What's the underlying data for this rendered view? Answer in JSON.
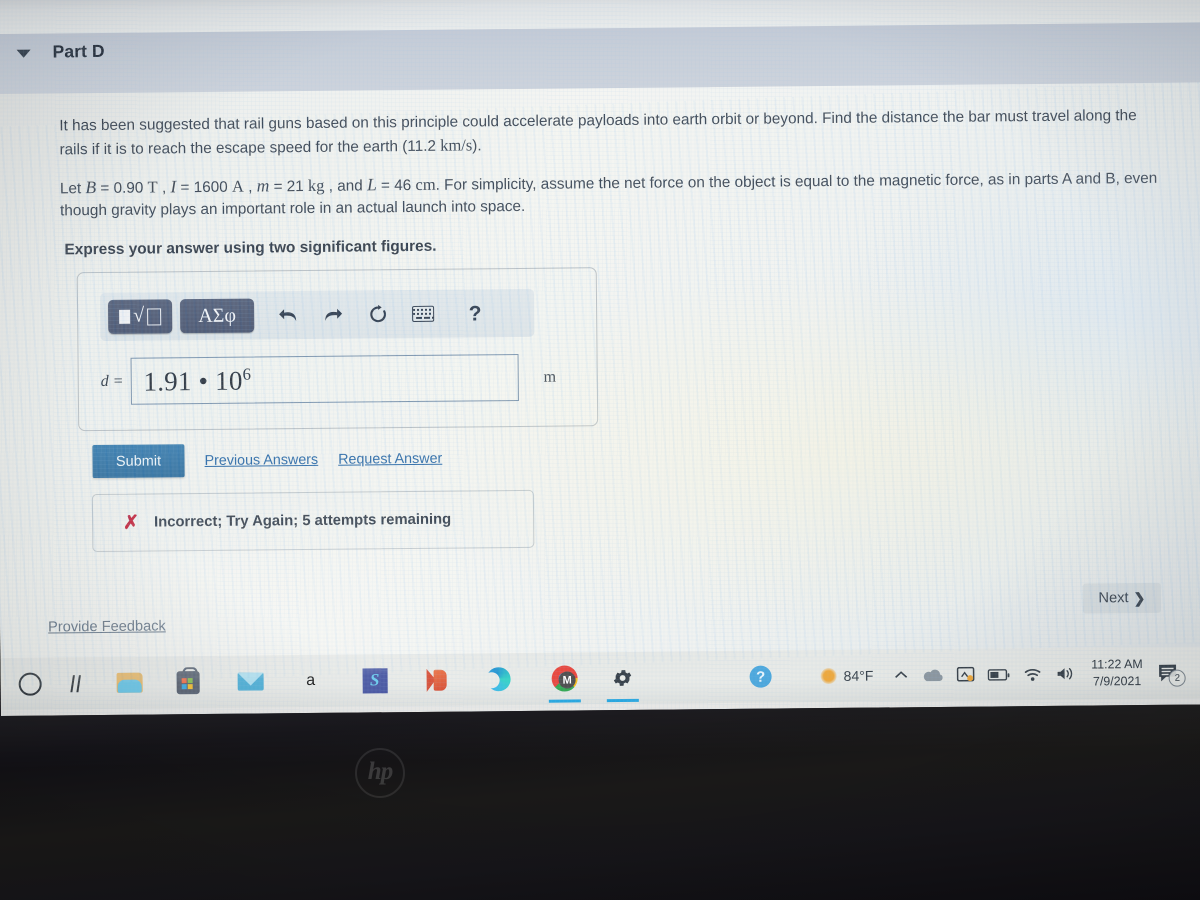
{
  "part": {
    "title": "Part D",
    "caret_icon": "caret-down-icon"
  },
  "problem": {
    "paragraph1_a": "It has been suggested that rail guns based on this principle could accelerate payloads into earth orbit or beyond. Find the distance the bar must travel along the rails if it is to reach the escape speed for the earth (11.2 ",
    "paragraph1_unit": "km/s",
    "paragraph1_b": ").",
    "p2_let": "Let ",
    "p2_B": "B",
    "p2_B_val": " = 0.90 ",
    "p2_B_unit": "T",
    "p2_sep1": " , ",
    "p2_I": "I",
    "p2_I_val": " = 1600 ",
    "p2_I_unit": "A",
    "p2_sep2": " , ",
    "p2_m": "m",
    "p2_m_val": " = 21 ",
    "p2_m_unit": "kg",
    "p2_sep3": " , and ",
    "p2_L": "L",
    "p2_L_val": " = 46 ",
    "p2_L_unit": "cm",
    "p2_tail": ". For simplicity, assume the net force on the object is equal to the magnetic force, as in parts A and B, even though gravity plays an important role in an actual launch into space.",
    "instruction": "Express your answer using two significant figures."
  },
  "math_toolbar": {
    "template_button": {
      "name": "template-button",
      "root_glyph": "√"
    },
    "greek_button": {
      "name": "greek-symbols-button",
      "label": "ΑΣφ"
    },
    "icons": [
      {
        "name": "undo-icon",
        "title": "undo"
      },
      {
        "name": "redo-icon",
        "title": "redo"
      },
      {
        "name": "reset-icon",
        "title": "reset"
      },
      {
        "name": "keyboard-icon",
        "title": "keyboard"
      },
      {
        "name": "help-icon",
        "label": "?"
      }
    ]
  },
  "answer": {
    "variable_label": "d =",
    "value_mantissa": "1.91 • 10",
    "value_exponent": "6",
    "unit": "m"
  },
  "actions": {
    "submit_label": "Submit",
    "previous_answers_label": "Previous Answers",
    "request_answer_label": "Request Answer"
  },
  "feedback": {
    "mark": "✗",
    "message": "Incorrect; Try Again; 5 attempts remaining"
  },
  "footer": {
    "provide_feedback_label": "Provide Feedback",
    "next_label": "Next",
    "next_chevron": "❯"
  },
  "taskbar": {
    "items": [
      {
        "name": "cortana-search-icon",
        "label": ""
      },
      {
        "name": "task-view-icon",
        "label": ""
      },
      {
        "name": "file-explorer-icon",
        "label": ""
      },
      {
        "name": "microsoft-store-icon",
        "label": ""
      },
      {
        "name": "mail-icon",
        "label": ""
      },
      {
        "name": "letter-a-icon",
        "label": "a"
      },
      {
        "name": "blue-s-app-icon",
        "label": "S"
      },
      {
        "name": "office-icon",
        "label": ""
      },
      {
        "name": "edge-browser-icon",
        "label": ""
      },
      {
        "name": "chrome-browser-icon",
        "label": "M"
      },
      {
        "name": "settings-gear-icon",
        "label": ""
      },
      {
        "name": "help-circle-icon",
        "label": "?"
      }
    ],
    "tray": {
      "weather_temp": "84°F",
      "chevron_up": "⌃",
      "time": "11:22 AM",
      "date": "7/9/2021",
      "notification_count": "2"
    }
  },
  "device": {
    "brand_logo": "hp"
  },
  "colors": {
    "submit_blue": "#3d7fb0",
    "link_blue": "#2f6ca8",
    "error_red": "#c0223b",
    "math_button": "#4a5570",
    "header_band": "#c8cfd9"
  }
}
